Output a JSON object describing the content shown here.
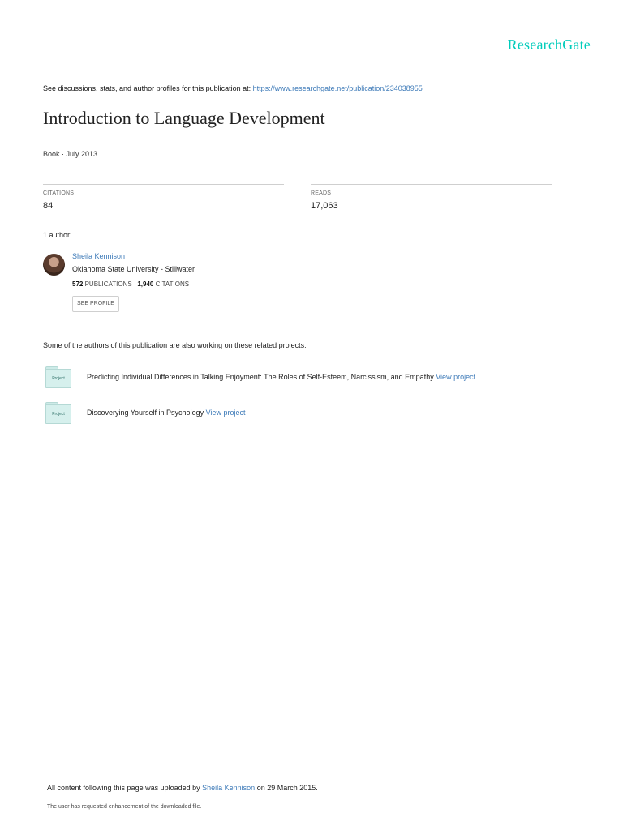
{
  "brand": "ResearchGate",
  "discuss": {
    "prefix": "See discussions, stats, and author profiles for this publication at: ",
    "url": "https://www.researchgate.net/publication/234038955"
  },
  "title": "Introduction to Language Development",
  "meta": "Book · July 2013",
  "stats": {
    "citations_label": "CITATIONS",
    "citations_value": "84",
    "reads_label": "READS",
    "reads_value": "17,063"
  },
  "authors_heading": "1 author:",
  "author": {
    "name": "Sheila Kennison",
    "institution": "Oklahoma State University - Stillwater",
    "publications_count": "572",
    "publications_label": "PUBLICATIONS",
    "citations_count": "1,940",
    "citations_label": "CITATIONS",
    "see_profile": "SEE PROFILE"
  },
  "related_heading": "Some of the authors of this publication are also working on these related projects:",
  "projects": [
    {
      "icon_label": "Project",
      "text": "Predicting Individual Differences in Talking Enjoyment: The Roles of Self-Esteem, Narcissism, and Empathy",
      "link": "View project"
    },
    {
      "icon_label": "Project",
      "text": "Discoverying Yourself in Psychology",
      "link": "View project"
    }
  ],
  "footer": {
    "prefix": "All content following this page was uploaded by ",
    "uploader": "Sheila Kennison",
    "suffix": " on 29 March 2015.",
    "note": "The user has requested enhancement of the downloaded file."
  }
}
